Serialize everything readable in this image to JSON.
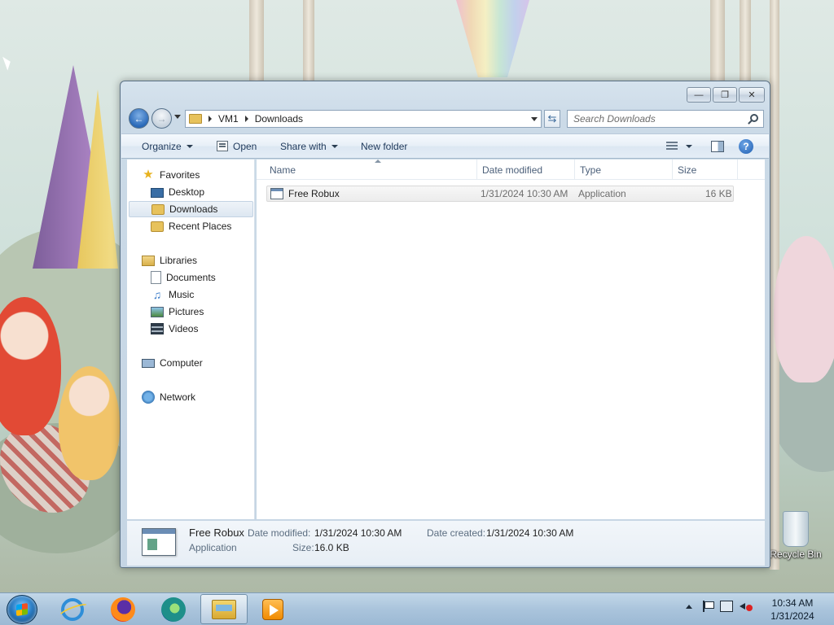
{
  "window": {
    "search_placeholder": "Search Downloads",
    "breadcrumb": [
      "VM1",
      "Downloads"
    ]
  },
  "toolbar": {
    "organize": "Organize",
    "open": "Open",
    "share_with": "Share with",
    "new_folder": "New folder",
    "help": "?"
  },
  "nav": {
    "favorites": "Favorites",
    "desktop": "Desktop",
    "downloads": "Downloads",
    "recent_places": "Recent Places",
    "libraries": "Libraries",
    "documents": "Documents",
    "music": "Music",
    "pictures": "Pictures",
    "videos": "Videos",
    "computer": "Computer",
    "network": "Network"
  },
  "columns": {
    "name": "Name",
    "date_modified": "Date modified",
    "type": "Type",
    "size": "Size"
  },
  "files": [
    {
      "name": "Free Robux",
      "date_modified": "1/31/2024 10:30 AM",
      "type": "Application",
      "size": "16 KB"
    }
  ],
  "details": {
    "name": "Free Robux",
    "type": "Application",
    "date_modified_label": "Date modified:",
    "date_modified": "1/31/2024 10:30 AM",
    "date_created_label": "Date created:",
    "date_created": "1/31/2024 10:30 AM",
    "size_label": "Size:",
    "size": "16.0 KB"
  },
  "desktop": {
    "recycle_bin": "Recycle Bin"
  },
  "taskbar": {
    "time": "10:34 AM",
    "date": "1/31/2024"
  }
}
